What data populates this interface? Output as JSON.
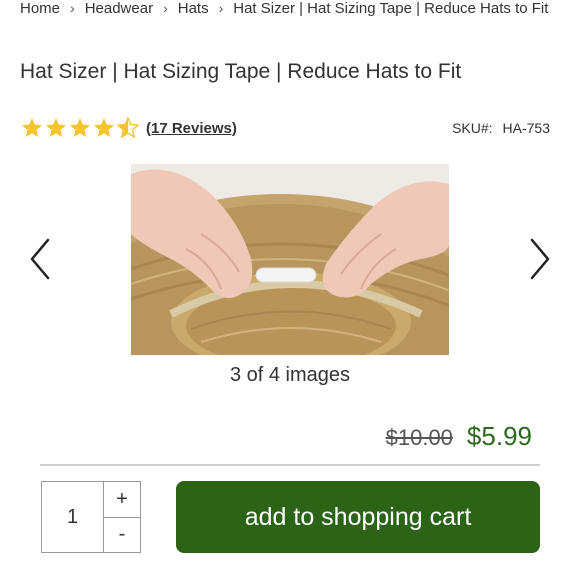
{
  "breadcrumb": {
    "items": [
      "Home",
      "Headwear",
      "Hats",
      "Hat Sizer | Hat Sizing Tape | Reduce Hats to Fit"
    ]
  },
  "product": {
    "title": "Hat Sizer | Hat Sizing Tape | Reduce Hats to Fit",
    "rating": 4.5,
    "rating_max": 5,
    "reviews_label": "(17 Reviews)",
    "sku_label": "SKU#:",
    "sku_value": "HA-753"
  },
  "gallery": {
    "counter": "3 of 4 images",
    "prev_icon": "chevron-left-icon",
    "next_icon": "chevron-right-icon"
  },
  "price": {
    "old": "$10.00",
    "new": "$5.99"
  },
  "quantity": {
    "value": "1",
    "plus": "+",
    "minus": "-"
  },
  "cart": {
    "label": "add to shopping cart"
  },
  "colors": {
    "star": "#f4c430",
    "price_green": "#2d6a1e",
    "button_green": "#2c6417"
  }
}
